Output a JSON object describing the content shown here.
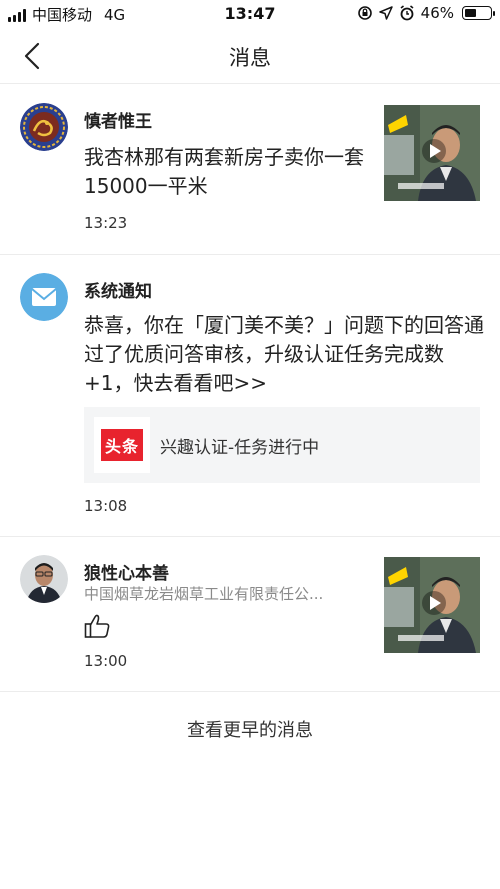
{
  "status_bar": {
    "carrier": "中国移动",
    "network": "4G",
    "time": "13:47",
    "battery": "46%",
    "battery_level": 0.46
  },
  "nav": {
    "title": "消息",
    "back_icon": "chevron-left-icon"
  },
  "messages": [
    {
      "sender": "慎者惟王",
      "text": "我杏林那有两套新房子卖你一套15000一平米",
      "time": "13:23",
      "avatar_icon": "dragon-emblem-avatar",
      "thumbnail_icon": "video-thumbnail"
    },
    {
      "sender": "系统通知",
      "text": "恭喜，你在「厦门美不美？」问题下的回答通过了优质问答审核，升级认证任务完成数+1，快去看看吧>>",
      "time": "13:08",
      "avatar_icon": "mail-icon",
      "card": {
        "logo_text": "头条",
        "label": "兴趣认证-任务进行中"
      }
    },
    {
      "sender": "狼性心本善",
      "subtitle": "中国烟草龙岩烟草工业有限责任公...",
      "time": "13:00",
      "avatar_icon": "person-avatar",
      "action_icon": "thumbs-up-icon",
      "thumbnail_icon": "video-thumbnail"
    }
  ],
  "footer": {
    "more_label": "查看更早的消息"
  },
  "colors": {
    "mail_blue": "#5aaee3",
    "toutiao_red": "#e8232e",
    "divider": "#ececec"
  }
}
